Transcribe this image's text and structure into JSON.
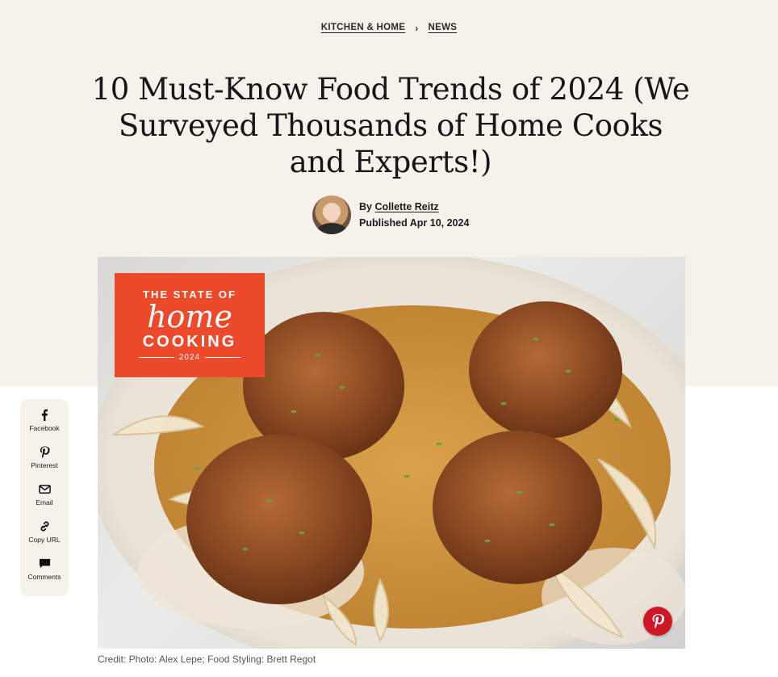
{
  "breadcrumb": {
    "items": [
      "KITCHEN & HOME",
      "NEWS"
    ],
    "separator": "›"
  },
  "article": {
    "title": "10 Must-Know Food Trends of 2024 (We Surveyed Thousands of Home Cooks and Experts!)",
    "by_prefix": "By",
    "author": "Collette Reitz",
    "published": "Published Apr 10, 2024"
  },
  "hero": {
    "badge_line1": "THE STATE OF",
    "badge_line2": "home",
    "badge_line3": "COOKING",
    "badge_line4": "2024",
    "credit": "Credit: Photo: Alex Lepe; Food Styling: Brett Regot"
  },
  "share": [
    {
      "label": "Facebook",
      "icon": "facebook-icon"
    },
    {
      "label": "Pinterest",
      "icon": "pinterest-icon"
    },
    {
      "label": "Email",
      "icon": "email-icon"
    },
    {
      "label": "Copy URL",
      "icon": "link-icon"
    },
    {
      "label": "Comments",
      "icon": "comment-icon"
    }
  ],
  "colors": {
    "hero_background": "#f5f1eb",
    "badge": "#ec4a2a",
    "pinterest": "#cf1727"
  }
}
